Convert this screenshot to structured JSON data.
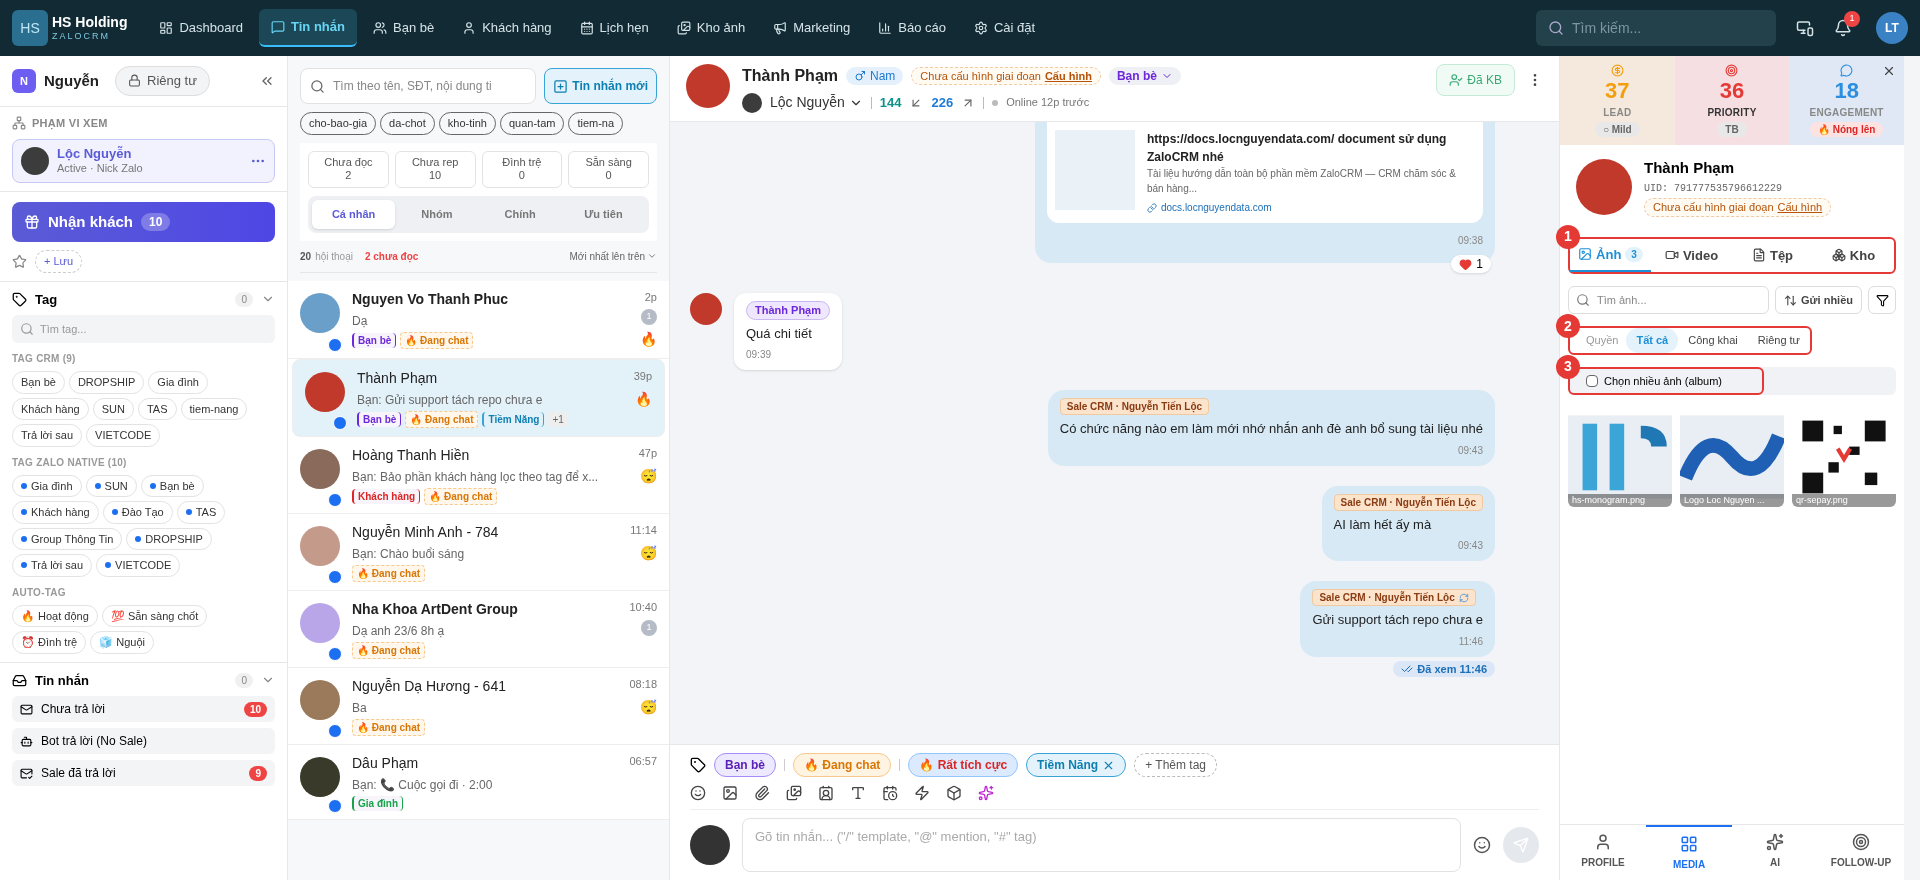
{
  "topbar": {
    "logo": "HS",
    "brand": "HS Holding",
    "sub": "ZALOCRM",
    "nav": [
      {
        "label": "Dashboard",
        "selected": false
      },
      {
        "label": "Tin nhắn",
        "selected": true
      },
      {
        "label": "Bạn bè",
        "selected": false
      },
      {
        "label": "Khách hàng",
        "selected": false
      },
      {
        "label": "Lịch hẹn",
        "selected": false
      },
      {
        "label": "Kho ảnh",
        "selected": false
      },
      {
        "label": "Marketing",
        "selected": false
      },
      {
        "label": "Báo cáo",
        "selected": false
      },
      {
        "label": "Cài đặt",
        "selected": false
      }
    ],
    "search_placeholder": "Tìm kiếm...",
    "notifications": "1",
    "avatar": "LT"
  },
  "sidebar": {
    "initial": "N",
    "name": "Nguyễn",
    "privacy": "Riêng tư",
    "scope_title": "PHẠM VI XEM",
    "account": {
      "name": "Lộc Nguyễn",
      "status": "Active · Nick Zalo"
    },
    "receive": {
      "label": "Nhận khách",
      "count": "10"
    },
    "save": "+ Lưu",
    "tag_section": {
      "title": "Tag",
      "count": "0",
      "placeholder": "Tìm tag...",
      "groups": [
        {
          "title": "TAG CRM (9)",
          "kind": "plain",
          "tags": [
            "Bạn bè",
            "DROPSHIP",
            "Gia đình",
            "Khách hàng",
            "SUN",
            "TAS",
            "tiem-nang",
            "Trả lời sau",
            "VIETCODE"
          ]
        },
        {
          "title": "TAG ZALO NATIVE (10)",
          "kind": "dot",
          "tags": [
            "Gia đình",
            "SUN",
            "Bạn bè",
            "Khách hàng",
            "Đào Tạo",
            "TAS",
            "Group Thông Tin",
            "DROPSHIP",
            "Trả lời sau",
            "VIETCODE"
          ]
        },
        {
          "title": "AUTO-TAG",
          "kind": "plain",
          "tags": [
            "🔥 Hoạt động",
            "💯 Sẵn sàng chốt",
            "⏰ Đình trệ",
            "🧊 Nguội"
          ]
        }
      ]
    },
    "message_section": {
      "title": "Tin nhắn",
      "count": "0",
      "items": [
        {
          "label": "Chưa trả lời",
          "count": "10"
        },
        {
          "label": "Bot trả lời (No Sale)"
        },
        {
          "label": "Sale đã trả lời",
          "count": "9"
        }
      ]
    }
  },
  "conversations": {
    "placeholder": "Tìm theo tên, SĐT, nội dung ti",
    "new_button": "Tin nhắn mới",
    "quick_tags": [
      "cho-bao-gia",
      "da-chot",
      "kho-tinh",
      "quan-tam",
      "tiem-na"
    ],
    "stats": [
      {
        "label": "Chưa đọc",
        "value": "2"
      },
      {
        "label": "Chưa rep",
        "value": "10"
      },
      {
        "label": "Đình trệ",
        "value": "0"
      },
      {
        "label": "Sẵn sàng",
        "value": "0"
      }
    ],
    "tabs": [
      {
        "label": "Cá nhân",
        "selected": true
      },
      {
        "label": "Nhóm",
        "selected": false
      },
      {
        "label": "Chính",
        "selected": false
      },
      {
        "label": "Ưu tiên",
        "selected": false
      }
    ],
    "total": "20",
    "total_label": "hội thoại",
    "unread": "2 chưa đọc",
    "sort": "Mới nhất lên trên",
    "items": [
      {
        "name": "Nguyen Vo Thanh Phuc",
        "preview": "Dạ",
        "time": "2p",
        "badge": "1",
        "status": "🔥",
        "unread": true,
        "selected": false,
        "tags": [
          {
            "label": "Bạn bè",
            "kind": "zalo",
            "color": "#6d28d9"
          },
          {
            "label": "🔥 Đang chat",
            "kind": "hot"
          }
        ]
      },
      {
        "name": "Thành Phạm",
        "preview": "Bạn: Gửi support tách repo chưa e",
        "time": "39p",
        "status": "🔥",
        "unread": false,
        "selected": true,
        "more": "+1",
        "tags": [
          {
            "label": "Bạn bè",
            "kind": "zalo",
            "color": "#6d28d9"
          },
          {
            "label": "🔥 Đang chat",
            "kind": "hot"
          },
          {
            "label": "Tiềm Năng",
            "kind": "plain"
          }
        ]
      },
      {
        "name": "Hoàng Thanh Hiền",
        "preview": "Bạn: Bảo phần khách hàng lọc theo tag để x...",
        "time": "47p",
        "status": "😴",
        "unread": false,
        "selected": false,
        "tags": [
          {
            "label": "Khách hàng",
            "kind": "zalo",
            "color": "#dc2626"
          },
          {
            "label": "🔥 Đang chat",
            "kind": "hot"
          }
        ]
      },
      {
        "name": "Nguyễn Minh Anh - 784",
        "preview": "Bạn: Chào buổi sáng",
        "time": "11:14",
        "status": "😴",
        "unread": false,
        "selected": false,
        "tags": [
          {
            "label": "🔥 Đang chat",
            "kind": "hot"
          }
        ]
      },
      {
        "name": "Nha Khoa ArtDent Group",
        "preview": "Dạ anh 23/6 8h ạ",
        "time": "10:40",
        "badge": "1",
        "unread": true,
        "selected": false,
        "tags": [
          {
            "label": "🔥 Đang chat",
            "kind": "hot"
          }
        ]
      },
      {
        "name": "Nguyễn Dạ Hương - 641",
        "preview": "Ba",
        "time": "08:18",
        "status": "😴",
        "unread": false,
        "selected": false,
        "tags": [
          {
            "label": "🔥 Đang chat",
            "kind": "hot"
          }
        ]
      },
      {
        "name": "Dâu Phạm",
        "preview": "Bạn: 📞 Cuộc gọi đi · 2:00",
        "time": "06:57",
        "unread": false,
        "selected": false,
        "tags": [
          {
            "label": "Gia đình",
            "kind": "zalo",
            "color": "#16a34a"
          }
        ]
      }
    ]
  },
  "chat": {
    "name": "Thành Phạm",
    "gender": "Nam",
    "stage": "Chưa cấu hình giai đoạn",
    "stage_link": "Cấu hình",
    "relation": "Bạn bè",
    "account": "Lộc Nguyễn",
    "incoming": "144",
    "outgoing": "226",
    "online": "Online 12p trước",
    "friend_button": "Đã KB",
    "messages": [
      {
        "kind": "link",
        "title": "https://docs.locnguyendata.com/ document sử dụng ZaloCRM nhé",
        "desc": "Tài liệu hướng dẫn toàn bộ phần mềm ZaloCRM — CRM chăm sóc & bán hàng...",
        "domain": "docs.locnguyendata.com",
        "time": "09:38",
        "reaction": "1"
      },
      {
        "kind": "in",
        "sender": "Thành Phạm",
        "text": "Quá chi tiết",
        "time": "09:39"
      },
      {
        "kind": "out",
        "sender": "Sale CRM · Nguyễn Tiến Lộc",
        "text": "Có chức năng nào em làm mới nhớ nhắn anh đè anh bổ sung tài liệu nhé",
        "time": "09:43",
        "synced": false
      },
      {
        "kind": "out",
        "sender": "Sale CRM · Nguyễn Tiến Lộc",
        "text": "AI làm hết ấy mà",
        "time": "09:43",
        "synced": false
      },
      {
        "kind": "out",
        "sender": "Sale CRM · Nguyễn Tiến Lộc",
        "text": "Gửi support tách repo chưa e",
        "time": "11:46",
        "synced": true
      }
    ],
    "seen": "Đã xem 11:46",
    "tags": [
      {
        "label": "Bạn bè",
        "kind": "zalo"
      },
      {
        "label": "🔥 Đang chat",
        "kind": "hot"
      },
      {
        "label": "🔥 Rất tích cực",
        "kind": "positive"
      },
      {
        "label": "Tiềm Năng",
        "kind": "removable"
      }
    ],
    "add_tag": "+ Thêm tag",
    "placeholder": "Gõ tin nhắn... (\"/\" template, \"@\" mention, \"#\" tag)"
  },
  "panel": {
    "scores": [
      {
        "value": "37",
        "label": "LEAD",
        "badge": "○ Mild",
        "kind": "lead"
      },
      {
        "value": "36",
        "label": "PRIORITY",
        "badge": "TB",
        "kind": "priority"
      },
      {
        "value": "18",
        "label": "ENGAGEMENT",
        "badge": "🔥 Nóng lên",
        "kind": "engagement"
      }
    ],
    "name": "Thành Phạm",
    "uid": "UID: 791777535796612229",
    "stage": "Chưa cấu hình giai đoạn",
    "stage_link": "Cấu hình",
    "media_tabs": {
      "callout": "1",
      "items": [
        {
          "label": "Ảnh",
          "count": "3",
          "selected": true
        },
        {
          "label": "Video",
          "selected": false
        },
        {
          "label": "Tệp",
          "selected": false
        },
        {
          "label": "Kho",
          "selected": false
        }
      ]
    },
    "search_placeholder": "Tìm ảnh...",
    "send_many": "Gửi nhiều",
    "visibility": {
      "label": "Quyền",
      "callout": "2",
      "options": [
        {
          "label": "Tất cả",
          "selected": true
        },
        {
          "label": "Công khai",
          "selected": false
        },
        {
          "label": "Riêng tư",
          "selected": false
        }
      ]
    },
    "album": {
      "label": "Chọn nhiều ảnh (album)",
      "checked": false,
      "callout": "3"
    },
    "images": [
      {
        "caption": "hs-monogram.png",
        "kind": "monogram"
      },
      {
        "caption": "Logo Loc Nguyen ...",
        "kind": "wave"
      },
      {
        "caption": "qr-sepay.png",
        "kind": "qr"
      }
    ],
    "bottom_nav": [
      {
        "label": "PROFILE",
        "selected": false
      },
      {
        "label": "MEDIA",
        "selected": true
      },
      {
        "label": "AI",
        "selected": false
      },
      {
        "label": "FOLLOW-UP",
        "selected": false
      }
    ]
  }
}
